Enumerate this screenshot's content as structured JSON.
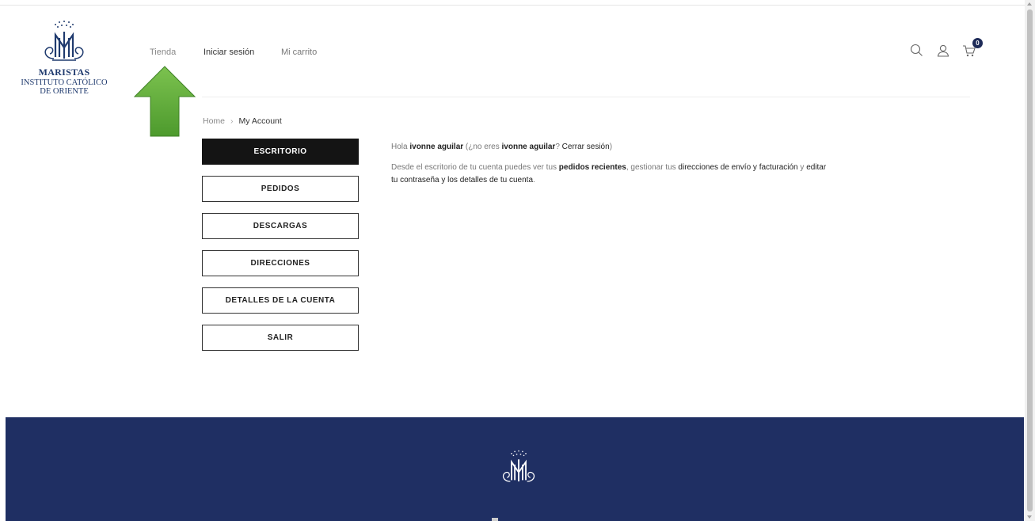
{
  "logo": {
    "line1": "MARISTAS",
    "line2": "INSTITUTO CATÓLICO",
    "line3": "DE ORIENTE"
  },
  "nav": {
    "items": [
      {
        "label": "Tienda"
      },
      {
        "label": "Iniciar sesión"
      },
      {
        "label": "Mi carrito"
      }
    ]
  },
  "header_icons": {
    "search": "search-icon",
    "account": "user-icon",
    "cart": "cart-icon",
    "cart_count": "0"
  },
  "breadcrumb": {
    "home": "Home",
    "separator": "›",
    "current": "My Account"
  },
  "account_menu": {
    "items": [
      {
        "label": "ESCRITORIO",
        "active": true
      },
      {
        "label": "PEDIDOS"
      },
      {
        "label": "DESCARGAS"
      },
      {
        "label": "DIRECCIONES"
      },
      {
        "label": "DETALLES DE LA CUENTA"
      },
      {
        "label": "SALIR"
      }
    ]
  },
  "dashboard": {
    "greeting_prefix": "Hola ",
    "user_name": "ivonne aguilar",
    "greeting_mid": " (¿no eres ",
    "user_name_2": "ivonne aguilar",
    "greeting_q": "? ",
    "logout_link": "Cerrar sesión",
    "greeting_end": ")",
    "desc_1": "Desde el escritorio de tu cuenta puedes ver tus ",
    "link_orders": "pedidos recientes",
    "desc_2": ", gestionar tus ",
    "link_addresses": "direcciones de envío y facturación",
    "desc_3": " y ",
    "link_account": "editar tu contraseña y los detalles de tu cuenta",
    "desc_4": "."
  },
  "colors": {
    "footer_bg": "#1f2f63",
    "arrow_green": "#5cab3a",
    "active_menu_bg": "#141414",
    "logo_blue": "#1f3a6e"
  }
}
